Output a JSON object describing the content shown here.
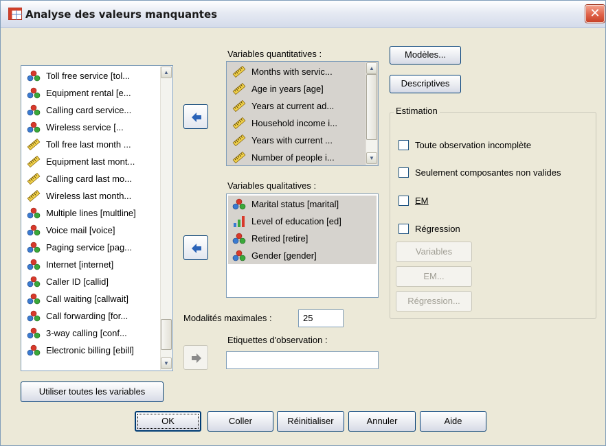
{
  "window": {
    "title": "Analyse des valeurs manquantes",
    "close_glyph": "✕"
  },
  "source_list": {
    "items": [
      {
        "label": "Toll free service [tol...",
        "icon": "nominal-icon"
      },
      {
        "label": "Equipment rental [e...",
        "icon": "nominal-icon"
      },
      {
        "label": "Calling card service...",
        "icon": "nominal-icon"
      },
      {
        "label": "Wireless service [...",
        "icon": "nominal-icon"
      },
      {
        "label": "Toll free last month ...",
        "icon": "scale-icon"
      },
      {
        "label": "Equipment last mont...",
        "icon": "scale-icon"
      },
      {
        "label": "Calling card last mo...",
        "icon": "scale-icon"
      },
      {
        "label": "Wireless last month...",
        "icon": "scale-icon"
      },
      {
        "label": "Multiple lines [multline]",
        "icon": "nominal-icon"
      },
      {
        "label": "Voice mail [voice]",
        "icon": "nominal-icon"
      },
      {
        "label": "Paging service [pag...",
        "icon": "nominal-icon"
      },
      {
        "label": "Internet [internet]",
        "icon": "nominal-icon"
      },
      {
        "label": "Caller ID [callid]",
        "icon": "nominal-icon"
      },
      {
        "label": "Call waiting [callwait]",
        "icon": "nominal-icon"
      },
      {
        "label": "Call forwarding [for...",
        "icon": "nominal-icon"
      },
      {
        "label": "3-way calling [conf...",
        "icon": "nominal-icon"
      },
      {
        "label": "Electronic billing [ebill]",
        "icon": "nominal-icon"
      }
    ]
  },
  "quantitative": {
    "label": "Variables quantitatives :",
    "items": [
      {
        "label": "Months with servic...",
        "icon": "scale-icon"
      },
      {
        "label": "Age in years [age]",
        "icon": "scale-icon"
      },
      {
        "label": "Years at current ad...",
        "icon": "scale-icon"
      },
      {
        "label": "Household income i...",
        "icon": "scale-icon"
      },
      {
        "label": "Years with current ...",
        "icon": "scale-icon"
      },
      {
        "label": "Number of people i...",
        "icon": "scale-icon"
      }
    ]
  },
  "qualitative": {
    "label": "Variables qualitatives :",
    "items": [
      {
        "label": "Marital status [marital]",
        "icon": "nominal-icon"
      },
      {
        "label": "Level of education [ed]",
        "icon": "ordinal-icon"
      },
      {
        "label": "Retired [retire]",
        "icon": "nominal-icon"
      },
      {
        "label": "Gender [gender]",
        "icon": "nominal-icon"
      }
    ]
  },
  "max_categories": {
    "label": "Modalités maximales :",
    "value": "25"
  },
  "case_labels": {
    "label": "Etiquettes d'observation :",
    "value": ""
  },
  "buttons": {
    "patterns": "Modèles...",
    "descriptives": "Descriptives",
    "use_all": "Utiliser toutes les variables",
    "ok": "OK",
    "paste": "Coller",
    "reset": "Réinitialiser",
    "cancel": "Annuler",
    "help": "Aide"
  },
  "estimation": {
    "title": "Estimation",
    "listwise": {
      "label": "Toute observation incomplète",
      "checked": false
    },
    "pairwise": {
      "label": "Seulement composantes non valides",
      "checked": false
    },
    "em": {
      "label": "EM",
      "checked": false
    },
    "regression": {
      "label": "Régression",
      "checked": false
    },
    "variables_btn": "Variables",
    "em_btn": "EM...",
    "regression_btn": "Régression..."
  }
}
